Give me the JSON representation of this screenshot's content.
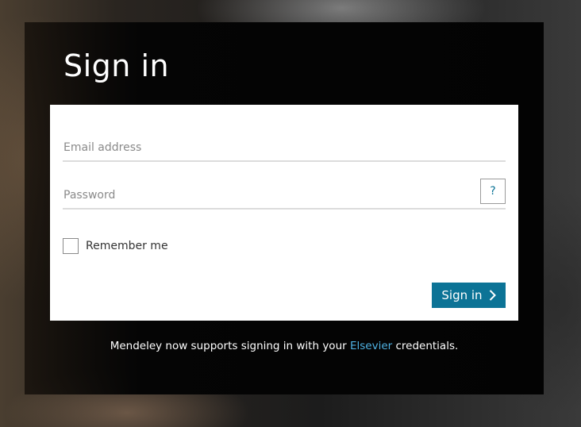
{
  "title": "Sign in",
  "form": {
    "email": {
      "placeholder": "Email address",
      "value": ""
    },
    "password": {
      "placeholder": "Password",
      "value": ""
    },
    "help_label": "?",
    "remember_label": "Remember me",
    "remember_checked": false,
    "submit_label": "Sign in",
    "submit_icon": "chevron-right-icon",
    "accent_color": "#0c7396"
  },
  "footer": {
    "text_before": "Mendeley now supports signing in with your ",
    "link": "Elsevier",
    "text_after": " credentials.",
    "link_color": "#4fb2e3"
  }
}
